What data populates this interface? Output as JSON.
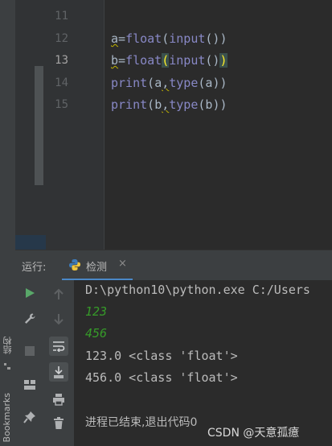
{
  "sidebar": {
    "structure_label": "结构",
    "bookmarks_label": "Bookmarks"
  },
  "editor": {
    "line_numbers": [
      "11",
      "12",
      "13",
      "14",
      "15"
    ],
    "current_line": "13",
    "lines": [
      {
        "v": "a",
        "fn1": "float",
        "fn2": "input",
        "tail": "())"
      },
      {
        "v": "b",
        "fn1": "float",
        "fn2": "input",
        "tail": ")"
      },
      {
        "fn": "print",
        "a1": "a",
        "fn2": "type",
        "a2": "a"
      },
      {
        "fn": "print",
        "a1": "b",
        "fn2": "type",
        "a2": "b"
      }
    ]
  },
  "run_panel": {
    "label": "运行:",
    "tab_label": "检测",
    "close_glyph": "×",
    "icons": [
      "run-icon",
      "up-arrow-icon",
      "wrench-icon",
      "down-arrow-icon",
      "stop-icon",
      "soft-wrap-icon",
      "layout-icon",
      "scroll-to-end-icon",
      "print-icon",
      "pin-icon",
      "trash-icon"
    ]
  },
  "console": {
    "command": "D:\\python10\\python.exe C:/Users",
    "input1": "123",
    "input2": "456",
    "out1": "123.0 <class 'float'>",
    "out2": "456.0 <class 'float'>",
    "exit_msg": "进程已结束,退出代码0"
  },
  "watermark": "CSDN @天意孤癔",
  "colors": {
    "accent": "#4a88c7",
    "input_text": "#369a29",
    "builtin": "#8888c6",
    "bracket_highlight": "#ffef28"
  }
}
